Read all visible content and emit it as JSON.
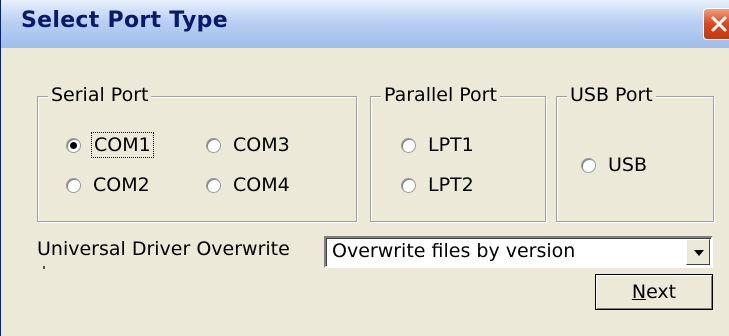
{
  "window": {
    "title": "Select Port Type",
    "close_icon": "close-icon"
  },
  "serial": {
    "legend": "Serial Port",
    "options": [
      {
        "label": "COM1",
        "checked": true,
        "focused": true
      },
      {
        "label": "COM3",
        "checked": false
      },
      {
        "label": "COM2",
        "checked": false
      },
      {
        "label": "COM4",
        "checked": false
      }
    ]
  },
  "parallel": {
    "legend": "Parallel Port",
    "options": [
      {
        "label": "LPT1",
        "checked": false
      },
      {
        "label": "LPT2",
        "checked": false
      }
    ]
  },
  "usb": {
    "legend": "USB Port",
    "options": [
      {
        "label": "USB",
        "checked": false
      }
    ]
  },
  "overwrite": {
    "label": "Universal Driver Overwrite",
    "selected": "Overwrite files by version",
    "arrow_icon": "chevron-down-icon"
  },
  "actions": {
    "next_mnemonic": "N",
    "next_rest": "ext"
  }
}
